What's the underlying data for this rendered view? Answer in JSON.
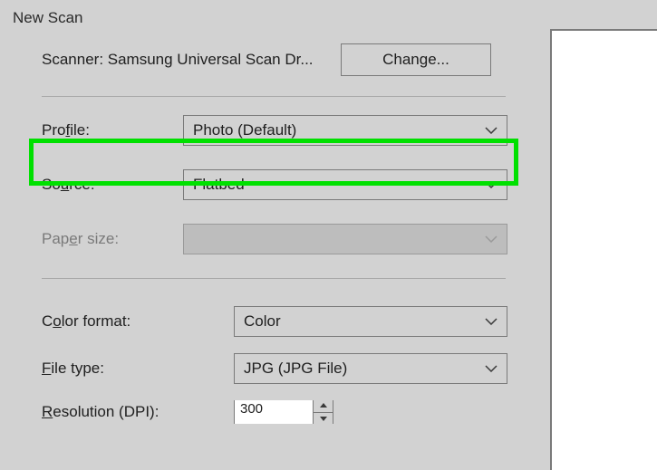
{
  "window": {
    "title": "New Scan"
  },
  "scanner": {
    "label": "Scanner: Samsung Universal Scan Dr...",
    "change_button": "Change..."
  },
  "fields": {
    "profile": {
      "label_pre": "Pro",
      "access": "f",
      "label_post": "ile:",
      "value": "Photo (Default)",
      "disabled": false
    },
    "source": {
      "label_pre": "So",
      "access": "u",
      "label_post": "rce:",
      "value": "Flatbed",
      "disabled": false
    },
    "paper_size": {
      "label_pre": "Pap",
      "access": "e",
      "label_post": "r size:",
      "value": "",
      "disabled": true
    },
    "color_format": {
      "label_pre": "C",
      "access": "o",
      "label_post": "lor format:",
      "value": "Color",
      "disabled": false
    },
    "file_type": {
      "label_pre": "",
      "access": "F",
      "label_post": "ile type:",
      "value": "JPG (JPG File)",
      "disabled": false
    },
    "resolution": {
      "label_pre": "",
      "access": "R",
      "label_post": "esolution (DPI):",
      "value": "300",
      "disabled": false
    }
  }
}
